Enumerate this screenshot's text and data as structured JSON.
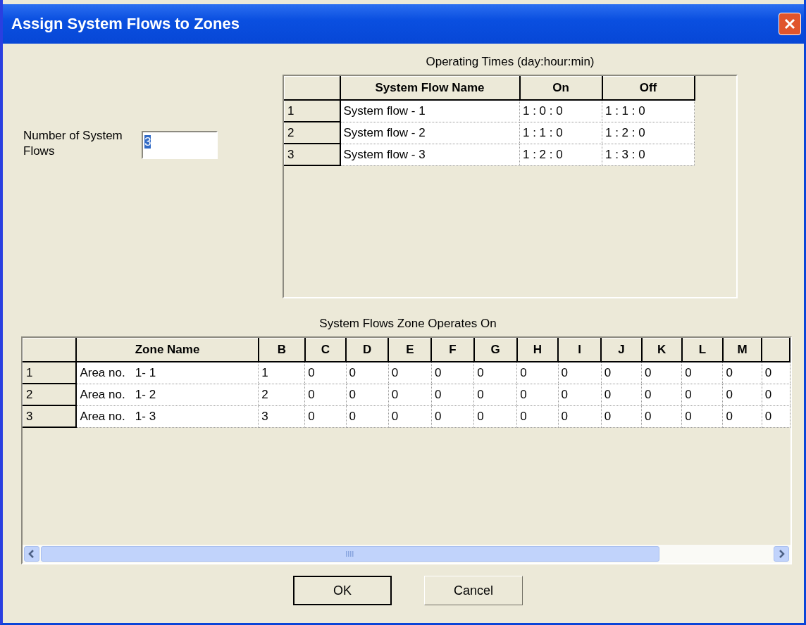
{
  "window": {
    "title": "Assign System Flows to Zones"
  },
  "number_field": {
    "label": "Number of System Flows",
    "value": "3",
    "text_selected": true
  },
  "operating_times": {
    "title": "Operating Times (day:hour:min)",
    "columns": [
      "System Flow Name",
      "On",
      "Off"
    ],
    "rows": [
      {
        "index": "1",
        "cells": [
          "System flow - 1",
          "1 : 0 : 0",
          "1 : 1 : 0"
        ]
      },
      {
        "index": "2",
        "cells": [
          "System flow - 2",
          "1 : 1 : 0",
          "1 : 2 : 0"
        ]
      },
      {
        "index": "3",
        "cells": [
          "System flow - 3",
          "1 : 2 : 0",
          "1 : 3 : 0"
        ]
      }
    ]
  },
  "zones": {
    "title": "System Flows Zone Operates On",
    "columns": [
      "Zone Name",
      "B",
      "C",
      "D",
      "E",
      "F",
      "G",
      "H",
      "I",
      "J",
      "K",
      "L",
      "M"
    ],
    "rows": [
      {
        "index": "1",
        "cells": [
          "Area no.   1- 1",
          "1",
          "0",
          "0",
          "0",
          "0",
          "0",
          "0",
          "0",
          "0",
          "0",
          "0",
          "0",
          "0"
        ]
      },
      {
        "index": "2",
        "cells": [
          "Area no.   1- 2",
          "2",
          "0",
          "0",
          "0",
          "0",
          "0",
          "0",
          "0",
          "0",
          "0",
          "0",
          "0",
          "0"
        ]
      },
      {
        "index": "3",
        "cells": [
          "Area no.   1- 3",
          "3",
          "0",
          "0",
          "0",
          "0",
          "0",
          "0",
          "0",
          "0",
          "0",
          "0",
          "0",
          "0"
        ]
      }
    ]
  },
  "buttons": [
    {
      "label": "OK",
      "default": true
    },
    {
      "label": "Cancel",
      "default": false
    }
  ]
}
